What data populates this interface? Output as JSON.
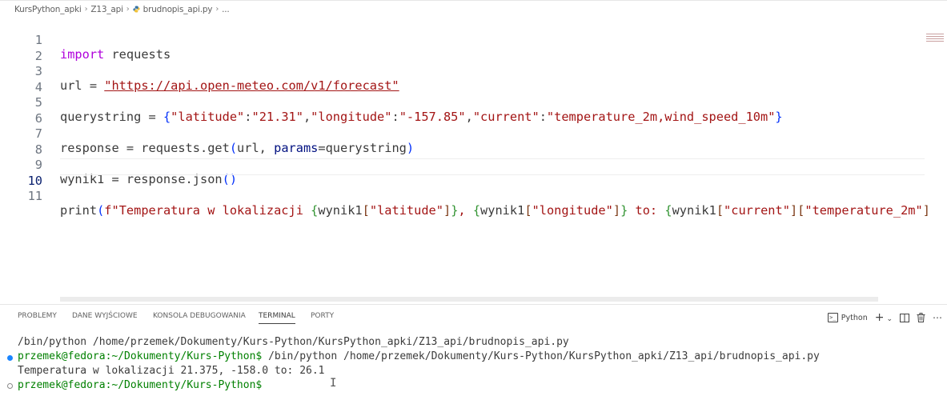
{
  "breadcrumb": {
    "folder1": "KursPython_apki",
    "folder2": "Z13_api",
    "file": "brudnopis_api.py",
    "ellipsis": "..."
  },
  "editor": {
    "line_numbers": [
      "1",
      "2",
      "3",
      "4",
      "5",
      "6",
      "7",
      "8",
      "9",
      "10",
      "11"
    ],
    "active_line": "10",
    "line1": {
      "kw": "import",
      "rest": " requests"
    },
    "line3": {
      "lhs": "url = ",
      "str": "\"https://api.open-meteo.com/v1/forecast\""
    },
    "line5": {
      "lhs": "querystring = ",
      "open": "{",
      "s1": "\"latitude\"",
      "c1": ":",
      "s2": "\"21.31\"",
      "c2": ",",
      "s3": "\"longitude\"",
      "c3": ":",
      "s4": "\"-157.85\"",
      "c4": ",",
      "s5": "\"current\"",
      "c5": ":",
      "s6": "\"temperature_2m,wind_speed_10m\"",
      "close": "}"
    },
    "line7": {
      "lhs": "response = requests.get",
      "open": "(",
      "arg1": "url, ",
      "param": "params",
      "eq": "=querystring",
      "close": ")"
    },
    "line9": {
      "lhs": "wynik1 = response.json",
      "open": "(",
      "close": ")"
    },
    "line11": {
      "fn": "print",
      "p_open": "(",
      "fstr1": "f\"Temperatura w lokalizacji ",
      "br1_open": "{",
      "v1": "wynik1",
      "sq1_open": "[",
      "k1": "\"latitude\"",
      "sq1_close": "]",
      "br1_close": "}",
      "mid": ", ",
      "br2_open": "{",
      "v2": "wynik1",
      "sq2_open": "[",
      "k2": "\"longitude\"",
      "sq2_close": "]",
      "br2_close": "}",
      "to": " to: ",
      "br3_open": "{",
      "v3": "wynik1",
      "sq3_open": "[",
      "k3": "\"current\"",
      "sq3_close": "]",
      "sq4_open": "[",
      "k4": "\"temperature_2m\"",
      "sq4_close": "]"
    }
  },
  "panel": {
    "tabs": [
      "PROBLEMY",
      "DANE WYJŚCIOWE",
      "KONSOLA DEBUGOWANIA",
      "TERMINAL",
      "PORTY"
    ],
    "active_tab": "TERMINAL",
    "terminal_name": "Python",
    "add": "+",
    "chevron": "⌄",
    "more": "⋯"
  },
  "terminal": {
    "line1": "/bin/python /home/przemek/Dokumenty/Kurs-Python/KursPython_apki/Z13_api/brudnopis_api.py",
    "line2_prompt": "przemek@fedora:~/Dokumenty/Kurs-Python$",
    "line2_cmd": " /bin/python /home/przemek/Dokumenty/Kurs-Python/KursPython_apki/Z13_api/brudnopis_api.py",
    "line3": "Temperatura w lokalizacji 21.375, -158.0 to: 26.1",
    "line4_prompt": "przemek@fedora:~/Dokumenty/Kurs-Python$"
  },
  "colors": {
    "keyword": "#af00db",
    "string": "#a31515",
    "bracket_level1": "#0431fa",
    "bracket_level2": "#319331",
    "bracket_level3": "#7b3814",
    "prompt": "#008000",
    "decoration_blue": "#1a85ff"
  }
}
